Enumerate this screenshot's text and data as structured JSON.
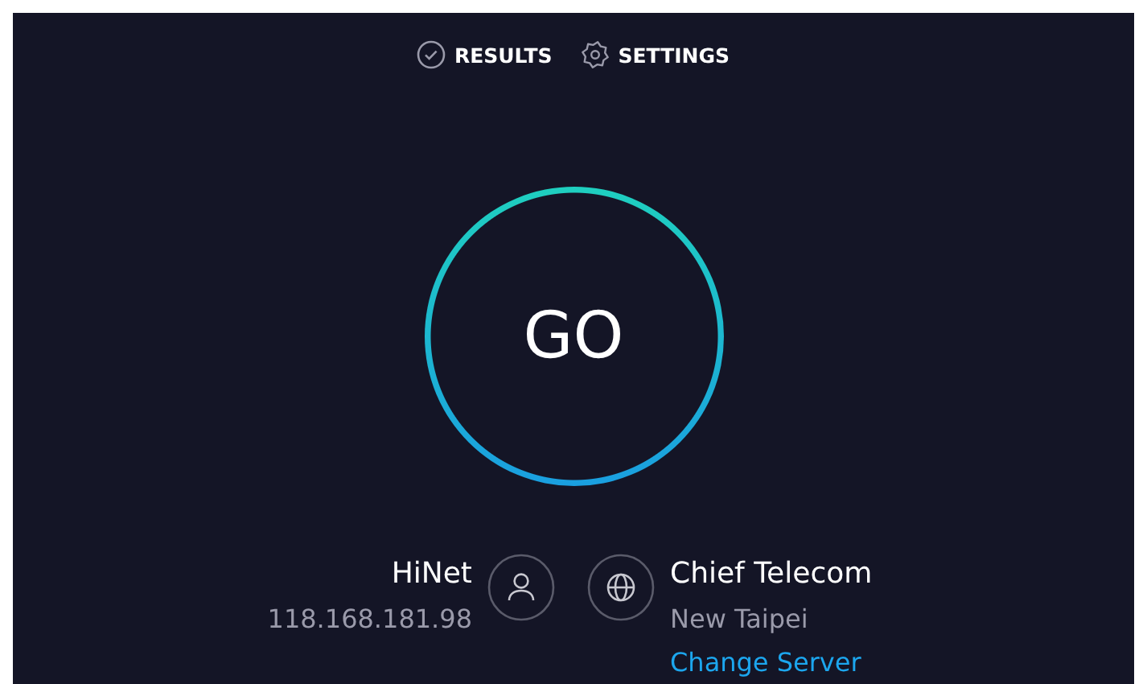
{
  "nav": [
    {
      "kind": "results",
      "label": "RESULTS"
    },
    {
      "kind": "settings",
      "label": "SETTINGS"
    }
  ],
  "start_button": {
    "label": "GO"
  },
  "provider": {
    "name": "HiNet",
    "ip": "118.168.181.98"
  },
  "server": {
    "name": "Chief Telecom",
    "location": "New Taipei",
    "link": "Change Server"
  }
}
